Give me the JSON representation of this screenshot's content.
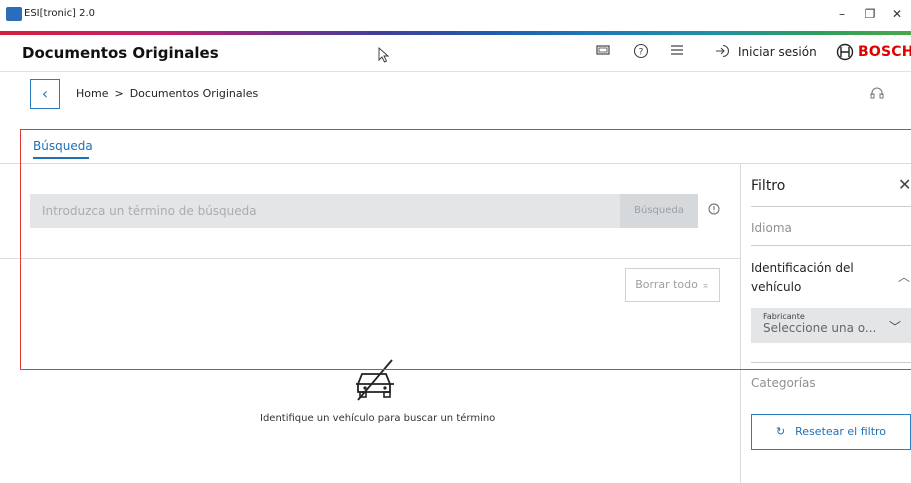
{
  "window": {
    "title": "ESI[tronic] 2.0"
  },
  "header": {
    "title": "Documentos Originales",
    "login_label": "Iniciar sesión",
    "brand": "BOSCH"
  },
  "breadcrumb": {
    "home": "Home",
    "separator": ">",
    "current": "Documentos Originales"
  },
  "tabs": [
    {
      "label": "Búsqueda",
      "active": true
    }
  ],
  "search": {
    "placeholder": "Introduzca un término de búsqueda",
    "button_label": "Búsqueda",
    "clear_all_label": "Borrar todo"
  },
  "filter": {
    "title": "Filtro",
    "language_label": "Idioma",
    "vehicle_id_label": "Identificación del vehículo",
    "manufacturer_label": "Fabricante",
    "manufacturer_value": "Seleccione una o...",
    "categories_label": "Categorías",
    "reset_label": "Resetear el filtro"
  },
  "main": {
    "message": "Identifique un vehículo para buscar un término"
  },
  "colors": {
    "accent": "#1f6fb5",
    "brand": "#e00000",
    "highlight": "#e53935"
  }
}
